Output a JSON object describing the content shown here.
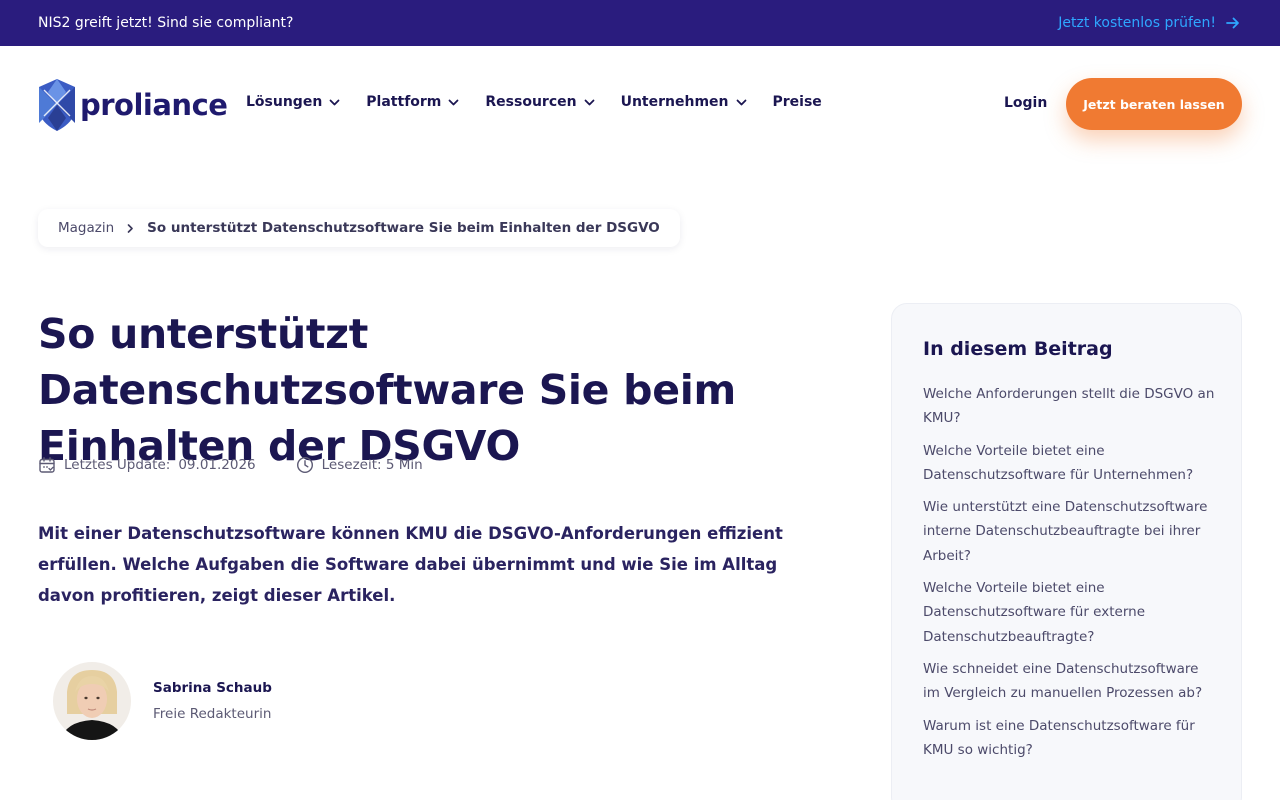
{
  "banner": {
    "text": "NIS2 greift jetzt! Sind sie compliant?",
    "cta_label": "Jetzt kostenlos prüfen!"
  },
  "header": {
    "logo_text": "proliance",
    "nav": [
      {
        "label": "Lösungen",
        "has_dropdown": true
      },
      {
        "label": "Plattform",
        "has_dropdown": true
      },
      {
        "label": "Ressourcen",
        "has_dropdown": true
      },
      {
        "label": "Unternehmen",
        "has_dropdown": true
      },
      {
        "label": "Preise",
        "has_dropdown": false
      }
    ],
    "login_label": "Login",
    "cta_label": "Jetzt beraten lassen"
  },
  "breadcrumb": {
    "parent": "Magazin",
    "current": "So unterstützt Datenschutzsoftware Sie beim Einhalten der DSGVO"
  },
  "article": {
    "title": "So unterstützt Datenschutzsoftware Sie beim Einhalten der DSGVO",
    "updated_label": "Letztes Update:",
    "updated_date": "09.01.2026",
    "reading_time": "Lesezeit: 5 Min",
    "lead": "Mit einer Datenschutzsoftware können KMU die DSGVO-Anforderungen effizient erfüllen. Welche Aufgaben die Software dabei übernimmt und wie Sie im Alltag davon profitieren, zeigt dieser Artikel."
  },
  "author": {
    "name": "Sabrina Schaub",
    "role": "Freie Redakteurin"
  },
  "toc": {
    "title": "In diesem Beitrag",
    "items": [
      "Welche Anforderungen stellt die DSGVO an KMU?",
      "Welche Vorteile bietet eine Datenschutzsoftware für Unternehmen?",
      "Wie unterstützt eine Datenschutzsoftware interne Datenschutzbeauftragte bei ihrer Arbeit?",
      "Welche Vorteile bietet eine Datenschutzsoftware für externe Datenschutzbeauftragte?",
      "Wie schneidet eine Datenschutzsoftware im Vergleich zu manuellen Prozessen ab?",
      "Warum ist eine Datenschutzsoftware für KMU so wichtig?"
    ]
  },
  "colors": {
    "banner_bg": "#2a1c7e",
    "accent_orange": "#f07a32",
    "link_blue": "#2ea7ff",
    "text_dark": "#1b1651"
  }
}
